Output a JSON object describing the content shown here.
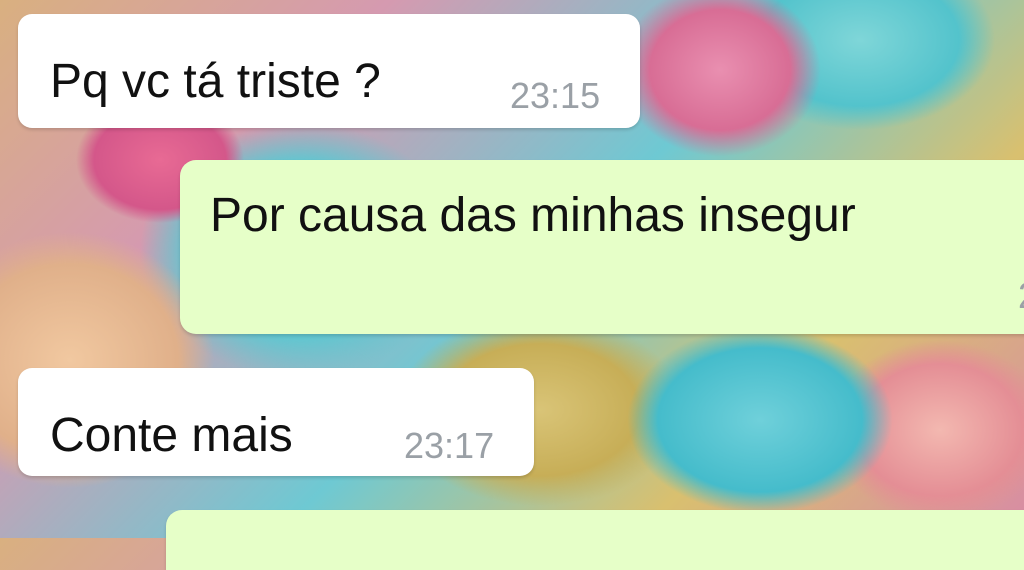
{
  "messages": [
    {
      "direction": "incoming",
      "text": "Pq vc tá triste ?",
      "time": "23:15"
    },
    {
      "direction": "outgoing",
      "text": "Por causa das minhas insegur",
      "time": "2"
    },
    {
      "direction": "incoming",
      "text": "Conte mais",
      "time": "23:17"
    },
    {
      "direction": "outgoing",
      "text": "",
      "time": ""
    }
  ],
  "colors": {
    "incoming_bubble": "#ffffff",
    "outgoing_bubble": "#e6ffc8",
    "message_text": "#111111",
    "timestamp": "#9aa0a6"
  }
}
